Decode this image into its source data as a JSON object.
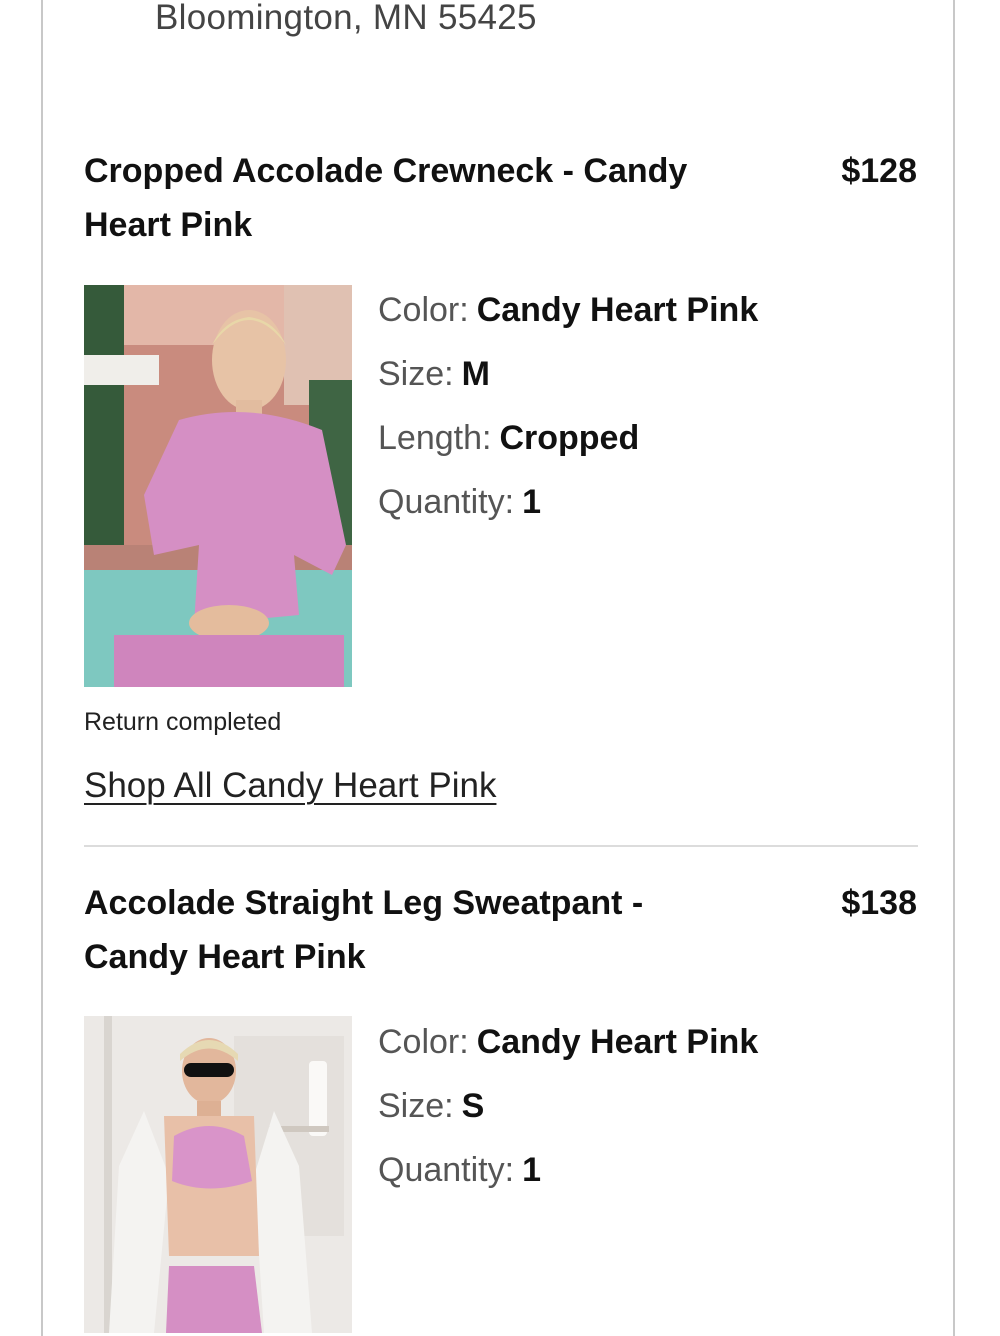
{
  "shipping": {
    "address_line": "Bloomington, MN 55425"
  },
  "items": [
    {
      "title_line1": "Cropped Accolade Crewneck - Candy",
      "title_line2": "Heart Pink",
      "price": "$128",
      "attributes": [
        {
          "label": "Color:",
          "value": "Candy Heart Pink"
        },
        {
          "label": "Size:",
          "value": "M"
        },
        {
          "label": "Length:",
          "value": "Cropped"
        },
        {
          "label": "Quantity:",
          "value": "1"
        }
      ],
      "status": "Return completed",
      "shop_link": "Shop All Candy Heart Pink"
    },
    {
      "title_line1": "Accolade Straight Leg Sweatpant -",
      "title_line2": "Candy Heart Pink",
      "price": "$138",
      "attributes": [
        {
          "label": "Color:",
          "value": "Candy Heart Pink"
        },
        {
          "label": "Size:",
          "value": "S"
        },
        {
          "label": "Quantity:",
          "value": "1"
        }
      ]
    }
  ],
  "colors": {
    "product_pink": "#d58fc4",
    "pool": "#7ec8c0",
    "wall": "#c98b7e"
  }
}
